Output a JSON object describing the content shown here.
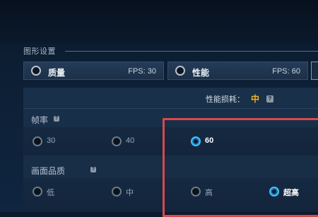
{
  "section_title": "图形设置",
  "modes": [
    {
      "label": "质量",
      "fps": "FPS: 30"
    },
    {
      "label": "性能",
      "fps": "FPS: 60"
    }
  ],
  "performance_cost": {
    "label": "性能损耗：",
    "value": "中",
    "help": "?"
  },
  "frame_rate": {
    "title": "帧率",
    "help": "?",
    "options": [
      "30",
      "40",
      "60"
    ],
    "selected": "60"
  },
  "picture_quality": {
    "title": "画面品质",
    "help": "?",
    "options": [
      "低",
      "中",
      "高",
      "超高"
    ],
    "selected": "超高"
  },
  "colors": {
    "accent": "#3ec3ff",
    "cost": "#f0b429",
    "highlight": "#d8494d"
  }
}
